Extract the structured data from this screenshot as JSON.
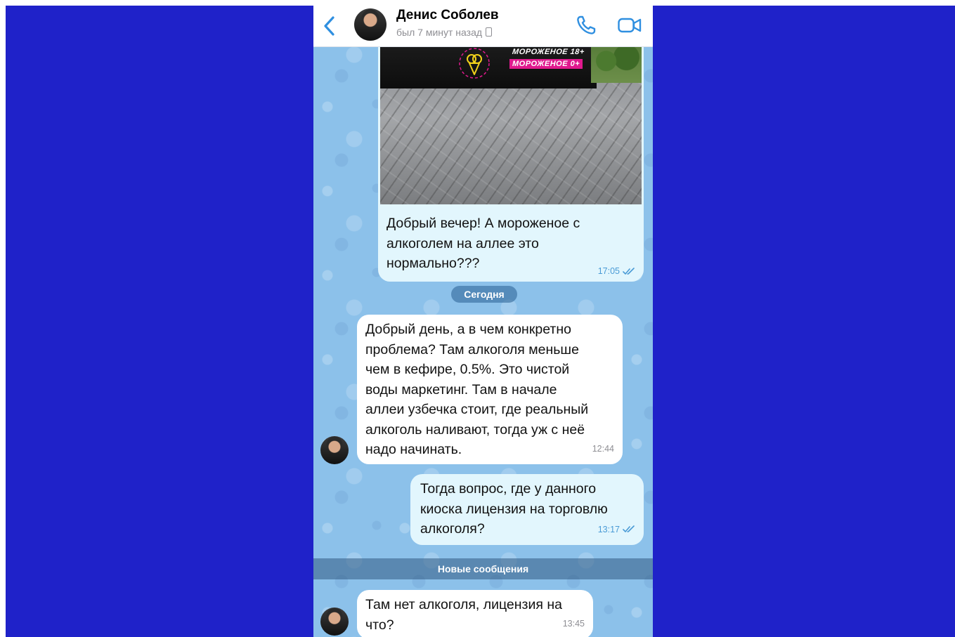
{
  "header": {
    "contact_name": "Денис Соболев",
    "status": "был 7 минут назад"
  },
  "messages": [
    {
      "type": "photo",
      "direction": "outgoing",
      "photo_signs": [
        "МОРОЖЕНОЕ 18+",
        "МОРОЖЕНОЕ 0+"
      ],
      "text": "Добрый вечер! А мороженое с\nалкоголем на аллее это\nнормально???",
      "time": "17:05",
      "status": "read"
    },
    {
      "type": "text",
      "direction": "incoming",
      "text": "Добрый день, а в чем конкретно\nпроблема? Там алкоголя меньше\nчем в кефире, 0.5%. Это чистой\nводы маркетинг. Там в начале\nаллеи узбечка стоит, где реальный\nалкоголь наливают, тогда уж с неё\nнадо начинать.",
      "time": "12:44"
    },
    {
      "type": "text",
      "direction": "outgoing",
      "text": "Тогда вопрос, где у данного\nкиоска лицензия на торговлю\nалкоголя?",
      "time": "13:17",
      "status": "read"
    },
    {
      "type": "text",
      "direction": "incoming",
      "text": "Там нет алкоголя, лицензия на\nчто?",
      "time": "13:45"
    }
  ],
  "separators": {
    "date": "Сегодня",
    "new_messages": "Новые сообщения"
  },
  "colors": {
    "backdrop": "#1f22c9",
    "chat_background": "#8cc1ea",
    "outgoing_bubble": "#e2f6fd",
    "incoming_bubble": "#ffffff",
    "accent": "#2f8fe0"
  },
  "icons": {
    "back": "chevron-left-icon",
    "call": "phone-icon",
    "video": "video-camera-icon",
    "read": "double-check-icon"
  }
}
